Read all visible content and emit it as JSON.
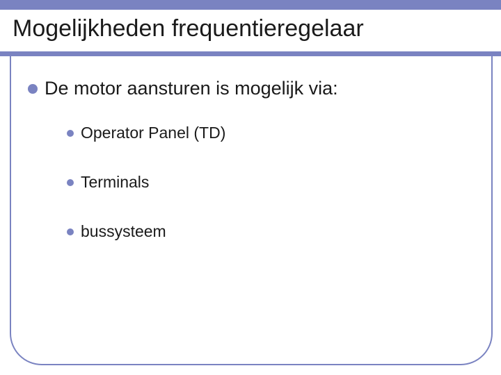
{
  "slide": {
    "title": "Mogelijkheden frequentieregelaar",
    "main_bullet": "De motor aansturen is mogelijk via:",
    "sub_bullets": [
      "Operator Panel (TD)",
      "Terminals",
      "bussysteem"
    ]
  },
  "colors": {
    "accent": "#7a83c1"
  }
}
